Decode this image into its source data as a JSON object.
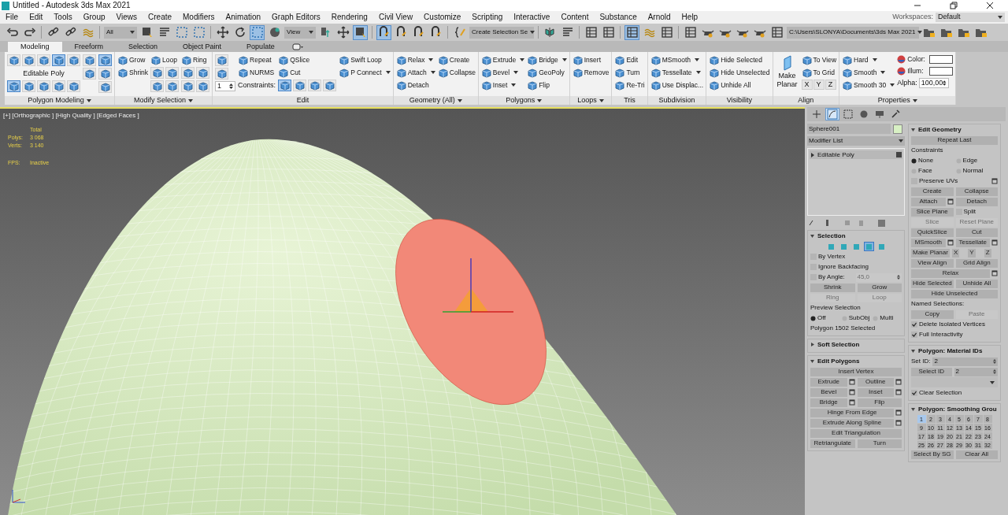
{
  "window": {
    "title": "Untitled - Autodesk 3ds Max 2021"
  },
  "menu": [
    "File",
    "Edit",
    "Tools",
    "Group",
    "Views",
    "Create",
    "Modifiers",
    "Animation",
    "Graph Editors",
    "Rendering",
    "Civil View",
    "Customize",
    "Scripting",
    "Interactive",
    "Content",
    "Substance",
    "Arnold",
    "Help"
  ],
  "workspaces": {
    "label": "Workspaces:",
    "value": "Default"
  },
  "main_toolbar": {
    "buttons": [
      {
        "selected": false
      },
      {
        "selected": false
      },
      {
        "selected": false
      },
      {
        "selected": false
      },
      {
        "selected": false
      },
      {
        "selected": false
      },
      {
        "selected": false
      },
      {
        "selected": false
      },
      {
        "selected": false
      },
      {
        "selected": false
      },
      {
        "selected": false
      },
      {
        "selected": true
      },
      {
        "selected": false
      },
      {
        "selected": false
      },
      {
        "selected": false
      },
      {
        "selected": true
      },
      {
        "selected": true
      },
      {
        "selected": false
      },
      {
        "selected": false
      },
      {
        "selected": false
      },
      {
        "selected": false
      },
      {
        "selected": false
      },
      {
        "selected": false
      },
      {
        "selected": false
      },
      {
        "selected": false
      },
      {
        "selected": true
      },
      {
        "selected": false
      },
      {
        "selected": false
      },
      {
        "selected": false
      },
      {
        "selected": false
      },
      {
        "selected": false
      },
      {
        "selected": false
      },
      {
        "selected": false
      },
      {
        "selected": false
      },
      {
        "selected": false
      },
      {
        "selected": false
      },
      {
        "selected": false
      },
      {
        "selected": false
      }
    ],
    "dropdowns": [
      {
        "value": "All"
      },
      {
        "value": "View"
      },
      {
        "value": "Create Selection Se"
      },
      {
        "value": "C:\\Users\\SLONYA\\Documents\\3ds Max 2021"
      }
    ]
  },
  "ribbon_tabs": [
    {
      "label": "Modeling",
      "selected": true
    },
    {
      "label": "Freeform",
      "selected": false
    },
    {
      "label": "Selection",
      "selected": false
    },
    {
      "label": "Object Paint",
      "selected": false
    },
    {
      "label": "Populate",
      "selected": false
    }
  ],
  "ribbon_groups": [
    {
      "title": "Polygon Modeling",
      "menu": true,
      "columns": [
        [
          {
            "kind": "icons",
            "icons": [
              {
                "selected": false
              },
              {
                "selected": false
              },
              {
                "selected": false
              },
              {
                "selected": true
              },
              {
                "selected": false
              }
            ]
          },
          {
            "kind": "text",
            "label": "Editable Poly"
          },
          {
            "kind": "icons",
            "icons": [
              {
                "selected": true
              },
              {
                "selected": false
              },
              {
                "selected": false
              },
              {
                "selected": false
              },
              {
                "selected": false
              }
            ]
          }
        ],
        [
          {
            "kind": "icon_column",
            "icons": [
              {
                "selected": false
              },
              {
                "selected": false
              }
            ]
          }
        ],
        [
          {
            "kind": "icon_column",
            "icons": [
              {
                "selected": true
              },
              {
                "selected": false
              },
              {
                "selected": false
              }
            ]
          }
        ]
      ]
    },
    {
      "title": "Modify Selection",
      "menu": true,
      "columns": [
        [
          {
            "kind": "button",
            "label": "Grow",
            "dropdown": false
          },
          {
            "kind": "button",
            "label": "Shrink",
            "dropdown": false
          }
        ],
        [
          {
            "kind": "button",
            "label": "Loop",
            "dropdown": false
          },
          {
            "kind": "icons",
            "icons": [
              {
                "selected": false
              },
              {
                "selected": false
              }
            ]
          },
          {
            "kind": "icons",
            "icons": [
              {
                "selected": false
              },
              {
                "selected": false
              }
            ]
          }
        ],
        [
          {
            "kind": "button",
            "label": "Ring",
            "dropdown": false
          },
          {
            "kind": "icons",
            "icons": [
              {
                "selected": false
              },
              {
                "selected": false
              }
            ]
          },
          {
            "kind": "icons",
            "icons": [
              {
                "selected": false
              },
              {
                "selected": false
              }
            ]
          }
        ]
      ]
    },
    {
      "title": "Edit",
      "menu": false,
      "columns": [
        [
          {
            "kind": "icon_column",
            "icons": [
              {
                "selected": false
              },
              {
                "selected": false
              }
            ]
          },
          {
            "kind": "spinner",
            "value": "1"
          }
        ],
        [
          {
            "kind": "button",
            "label": "Repeat",
            "dropdown": false
          },
          {
            "kind": "button",
            "label": "NURMS",
            "dropdown": false
          },
          {
            "kind": "text",
            "label": "Constraints:"
          }
        ],
        [
          {
            "kind": "button",
            "label": "QSlice",
            "dropdown": false
          },
          {
            "kind": "button",
            "label": "Cut",
            "dropdown": false
          },
          {
            "kind": "icons",
            "icons": [
              {
                "selected": true
              },
              {
                "selected": false
              },
              {
                "selected": false
              },
              {
                "selected": false
              }
            ]
          }
        ],
        [
          {
            "kind": "button",
            "label": "Swift Loop",
            "dropdown": false
          },
          {
            "kind": "button",
            "label": "P Connect",
            "dropdown": true
          }
        ]
      ]
    },
    {
      "title": "Geometry (All)",
      "menu": true,
      "columns": [
        [
          {
            "kind": "button",
            "label": "Relax",
            "dropdown": true
          },
          {
            "kind": "button",
            "label": "Attach",
            "dropdown": true
          },
          {
            "kind": "button",
            "label": "Detach",
            "dropdown": false
          }
        ],
        [
          {
            "kind": "button",
            "label": "Create",
            "dropdown": false
          },
          {
            "kind": "button",
            "label": "Collapse",
            "dropdown": false
          }
        ]
      ]
    },
    {
      "title": "Polygons",
      "menu": true,
      "columns": [
        [
          {
            "kind": "button",
            "label": "Extrude",
            "dropdown": true
          },
          {
            "kind": "button",
            "label": "Bevel",
            "dropdown": true
          },
          {
            "kind": "button",
            "label": "Inset",
            "dropdown": true
          }
        ],
        [
          {
            "kind": "button",
            "label": "Bridge",
            "dropdown": true
          },
          {
            "kind": "button",
            "label": "GeoPoly",
            "dropdown": false
          },
          {
            "kind": "button",
            "label": "Flip",
            "dropdown": false
          }
        ]
      ]
    },
    {
      "title": "Loops",
      "menu": true,
      "columns": [
        [
          {
            "kind": "button",
            "label": "Insert",
            "dropdown": false
          },
          {
            "kind": "button",
            "label": "Remove",
            "dropdown": false
          }
        ]
      ]
    },
    {
      "title": "Tris",
      "menu": false,
      "columns": [
        [
          {
            "kind": "button",
            "label": "Edit",
            "dropdown": false
          },
          {
            "kind": "button",
            "label": "Turn",
            "dropdown": false
          },
          {
            "kind": "button",
            "label": "Re-Tri",
            "dropdown": false
          }
        ]
      ]
    },
    {
      "title": "Subdivision",
      "menu": false,
      "columns": [
        [
          {
            "kind": "button",
            "label": "MSmooth",
            "dropdown": true
          },
          {
            "kind": "button",
            "label": "Tessellate",
            "dropdown": true
          },
          {
            "kind": "button",
            "label": "Use Displac...",
            "dropdown": false
          }
        ]
      ]
    },
    {
      "title": "Visibility",
      "menu": false,
      "columns": [
        [
          {
            "kind": "button",
            "label": "Hide Selected",
            "dropdown": false
          },
          {
            "kind": "button",
            "label": "Hide Unselected",
            "dropdown": false
          },
          {
            "kind": "button",
            "label": "Unhide All",
            "dropdown": false
          }
        ]
      ]
    },
    {
      "title": "Align",
      "menu": false,
      "columns": [
        [
          {
            "kind": "large_button",
            "label": "Make Planar"
          }
        ],
        [
          {
            "kind": "button",
            "label": "To View",
            "dropdown": false
          },
          {
            "kind": "button",
            "label": "To Grid",
            "dropdown": false
          },
          {
            "kind": "letters",
            "labels": [
              "X",
              "Y",
              "Z"
            ]
          }
        ]
      ]
    },
    {
      "title": "Properties",
      "menu": true,
      "columns": [
        [
          {
            "kind": "button",
            "label": "Hard",
            "dropdown": true
          },
          {
            "kind": "button",
            "label": "Smooth",
            "dropdown": true
          },
          {
            "kind": "button",
            "label": "Smooth 30",
            "dropdown": true
          }
        ],
        [
          {
            "kind": "swatch",
            "label": "Color:"
          },
          {
            "kind": "swatch",
            "label": "Illum:"
          },
          {
            "kind": "spinner",
            "label": "Alpha:",
            "value": "100,00"
          }
        ]
      ]
    }
  ],
  "viewport": {
    "label": "[+] [Orthographic ] [High Quality ] [Edged Faces ]",
    "stats_title": "Total",
    "stats": [
      {
        "label": "Polys:",
        "value": "3 068"
      },
      {
        "label": "Verts:",
        "value": "3 140"
      }
    ],
    "fps": {
      "label": "FPS:",
      "value": "Inactive"
    }
  },
  "command_panel": {
    "tabs": [
      {
        "selected": false
      },
      {
        "selected": true
      },
      {
        "selected": false
      },
      {
        "selected": false
      },
      {
        "selected": false
      },
      {
        "selected": false
      }
    ],
    "object_name": "Sphere001",
    "modifier_list": "Modifier List",
    "stack": [
      {
        "label": "Editable Poly",
        "expanded": false
      }
    ],
    "left_rollouts": [
      {
        "title": "Selection",
        "expanded": true,
        "rows": [
          [
            {
              "kind": "icons",
              "icons": [
                {
                  "selected": false
                },
                {
                  "selected": false
                },
                {
                  "selected": false
                },
                {
                  "selected": true
                },
                {
                  "selected": false
                }
              ]
            }
          ],
          [
            {
              "kind": "checkbox",
              "label": "By Vertex",
              "checked": false
            }
          ],
          [
            {
              "kind": "checkbox",
              "label": "Ignore Backfacing",
              "checked": false
            }
          ],
          [
            {
              "kind": "checkbox",
              "label": "By Angle:",
              "checked": false
            },
            {
              "kind": "spinner",
              "value": "45,0",
              "disabled": true
            }
          ],
          [
            {
              "kind": "button",
              "label": "Shrink",
              "disabled": false
            },
            {
              "kind": "button",
              "label": "Grow",
              "disabled": false
            }
          ],
          [
            {
              "kind": "button",
              "label": "Ring",
              "disabled": true
            },
            {
              "kind": "button",
              "label": "Loop",
              "disabled": true
            }
          ],
          [
            {
              "kind": "text",
              "label": "Preview Selection"
            }
          ],
          [
            {
              "kind": "radio",
              "label": "Off",
              "selected": true
            },
            {
              "kind": "radio",
              "label": "SubObj",
              "selected": false
            },
            {
              "kind": "radio",
              "label": "Multi",
              "selected": false
            }
          ],
          [
            {
              "kind": "text",
              "label": "Polygon 1502 Selected"
            }
          ]
        ]
      },
      {
        "title": "Soft Selection",
        "expanded": false
      },
      {
        "title": "Edit Polygons",
        "expanded": true,
        "rows": [
          [
            {
              "kind": "button",
              "label": "Insert Vertex",
              "disabled": false
            }
          ],
          [
            {
              "kind": "button",
              "label": "Extrude",
              "disabled": false,
              "settings": true
            },
            {
              "kind": "button",
              "label": "Outline",
              "disabled": false,
              "settings": true
            }
          ],
          [
            {
              "kind": "button",
              "label": "Bevel",
              "disabled": false,
              "settings": true
            },
            {
              "kind": "button",
              "label": "Inset",
              "disabled": false,
              "settings": true
            }
          ],
          [
            {
              "kind": "button",
              "label": "Bridge",
              "disabled": false,
              "settings": true
            },
            {
              "kind": "button",
              "label": "Flip",
              "disabled": false
            }
          ],
          [
            {
              "kind": "button",
              "label": "Hinge From Edge",
              "disabled": false,
              "settings": true
            }
          ],
          [
            {
              "kind": "button",
              "label": "Extrude Along Spline",
              "disabled": false,
              "settings": true
            }
          ],
          [
            {
              "kind": "button",
              "label": "Edit Triangulation",
              "disabled": false
            }
          ],
          [
            {
              "kind": "button",
              "label": "Retriangulate",
              "disabled": false
            },
            {
              "kind": "button",
              "label": "Turn",
              "disabled": false
            }
          ]
        ]
      }
    ],
    "right_rollouts": [
      {
        "title": "Edit Geometry",
        "expanded": true,
        "rows": [
          [
            {
              "kind": "button",
              "label": "Repeat Last",
              "disabled": false
            }
          ],
          [
            {
              "kind": "text",
              "label": "Constraints"
            }
          ],
          [
            {
              "kind": "radio",
              "label": "None",
              "selected": true
            },
            {
              "kind": "radio",
              "label": "Edge",
              "selected": false
            }
          ],
          [
            {
              "kind": "radio",
              "label": "Face",
              "selected": false
            },
            {
              "kind": "radio",
              "label": "Normal",
              "selected": false
            }
          ],
          [
            {
              "kind": "checkbox",
              "label": "Preserve UVs",
              "checked": false,
              "settings": true
            }
          ],
          [
            {
              "kind": "button",
              "label": "Create",
              "disabled": false
            },
            {
              "kind": "button",
              "label": "Collapse",
              "disabled": false
            }
          ],
          [
            {
              "kind": "button",
              "label": "Attach",
              "disabled": false,
              "settings": true
            },
            {
              "kind": "button",
              "label": "Detach",
              "disabled": false
            }
          ],
          [
            {
              "kind": "button",
              "label": "Slice Plane",
              "disabled": false
            },
            {
              "kind": "checkbox",
              "label": "Split",
              "checked": false
            }
          ],
          [
            {
              "kind": "button",
              "label": "Slice",
              "disabled": true
            },
            {
              "kind": "button",
              "label": "Reset Plane",
              "disabled": true
            }
          ],
          [
            {
              "kind": "button",
              "label": "QuickSlice",
              "disabled": false
            },
            {
              "kind": "button",
              "label": "Cut",
              "disabled": false
            }
          ],
          [
            {
              "kind": "button",
              "label": "MSmooth",
              "disabled": false,
              "settings": true
            },
            {
              "kind": "button",
              "label": "Tessellate",
              "disabled": false,
              "settings": true
            }
          ],
          [
            {
              "kind": "button",
              "label": "Make Planar",
              "disabled": false
            },
            {
              "kind": "button",
              "label": "X",
              "disabled": false
            },
            {
              "kind": "button",
              "label": "Y",
              "disabled": false
            },
            {
              "kind": "button",
              "label": "Z",
              "disabled": false
            }
          ],
          [
            {
              "kind": "button",
              "label": "View Align",
              "disabled": false
            },
            {
              "kind": "button",
              "label": "Grid Align",
              "disabled": false
            }
          ],
          [
            {
              "kind": "button",
              "label": "Relax",
              "disabled": false,
              "settings": true
            }
          ],
          [
            {
              "kind": "button",
              "label": "Hide Selected",
              "disabled": false
            },
            {
              "kind": "button",
              "label": "Unhide All",
              "disabled": false
            }
          ],
          [
            {
              "kind": "button",
              "label": "Hide Unselected",
              "disabled": false
            }
          ],
          [
            {
              "kind": "text",
              "label": "Named Selections:"
            }
          ],
          [
            {
              "kind": "button",
              "label": "Copy",
              "disabled": false
            },
            {
              "kind": "button",
              "label": "Paste",
              "disabled": true
            }
          ],
          [
            {
              "kind": "checkbox",
              "label": "Delete Isolated Vertices",
              "checked": true
            }
          ],
          [
            {
              "kind": "checkbox",
              "label": "Full Interactivity",
              "checked": true
            }
          ]
        ]
      },
      {
        "title": "Polygon: Material IDs",
        "expanded": true,
        "rows": [
          [
            {
              "kind": "spinner",
              "label": "Set ID:",
              "value": "2",
              "disabled": false
            }
          ],
          [
            {
              "kind": "button",
              "label": "Select ID",
              "disabled": false
            },
            {
              "kind": "spinner",
              "value": "2",
              "disabled": false
            }
          ],
          [
            {
              "kind": "dropdown"
            }
          ],
          [
            {
              "kind": "checkbox",
              "label": "Clear Selection",
              "checked": true
            }
          ]
        ]
      },
      {
        "title": "Polygon: Smoothing Grou",
        "expanded": true,
        "rows": [
          [
            {
              "kind": "groups",
              "items": [
                {
                  "label": "1",
                  "selected": true
                },
                {
                  "label": "2",
                  "selected": false
                },
                {
                  "label": "3",
                  "selected": false
                },
                {
                  "label": "4",
                  "selected": false
                },
                {
                  "label": "5",
                  "selected": false
                },
                {
                  "label": "6",
                  "selected": false
                },
                {
                  "label": "7",
                  "selected": false
                },
                {
                  "label": "8",
                  "selected": false
                },
                {
                  "label": "9",
                  "selected": false
                },
                {
                  "label": "10",
                  "selected": false
                },
                {
                  "label": "11",
                  "selected": false
                },
                {
                  "label": "12",
                  "selected": false
                },
                {
                  "label": "13",
                  "selected": false
                },
                {
                  "label": "14",
                  "selected": false
                },
                {
                  "label": "15",
                  "selected": false
                },
                {
                  "label": "16",
                  "selected": false
                },
                {
                  "label": "17",
                  "selected": false
                },
                {
                  "label": "18",
                  "selected": false
                },
                {
                  "label": "19",
                  "selected": false
                },
                {
                  "label": "20",
                  "selected": false
                },
                {
                  "label": "21",
                  "selected": false
                },
                {
                  "label": "22",
                  "selected": false
                },
                {
                  "label": "23",
                  "selected": false
                },
                {
                  "label": "24",
                  "selected": false
                },
                {
                  "label": "25",
                  "selected": false
                },
                {
                  "label": "26",
                  "selected": false
                },
                {
                  "label": "27",
                  "selected": false
                },
                {
                  "label": "28",
                  "selected": false
                },
                {
                  "label": "29",
                  "selected": false
                },
                {
                  "label": "30",
                  "selected": false
                },
                {
                  "label": "31",
                  "selected": false
                },
                {
                  "label": "32",
                  "selected": false
                }
              ]
            }
          ],
          [
            {
              "kind": "button",
              "label": "Select By SG",
              "disabled": false
            },
            {
              "kind": "button",
              "label": "Clear All",
              "disabled": false
            }
          ]
        ]
      }
    ]
  }
}
